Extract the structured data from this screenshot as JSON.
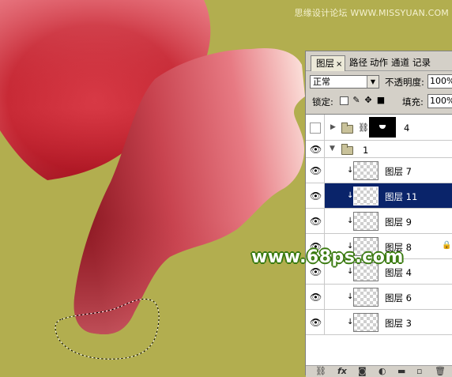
{
  "watermark_top": "思缘设计论坛 WWW.MISSYUAN.COM",
  "watermark_mid": "www.68ps.com",
  "colors": {
    "background": "#b2ae4f",
    "petal": "#d03a48",
    "selection": "#0a246a"
  },
  "panel": {
    "tabs": [
      {
        "label": "图层",
        "close": "×"
      },
      {
        "label": "路径"
      },
      {
        "label": "动作"
      },
      {
        "label": "通道"
      },
      {
        "label": "记录"
      }
    ],
    "blend_mode": "正常",
    "opacity_label": "不透明度:",
    "opacity_value": "100%",
    "lock_label": "锁定:",
    "fill_label": "填充:",
    "fill_value": "100%",
    "layers": [
      {
        "name": "4",
        "type": "group",
        "visible": false,
        "expanded": false
      },
      {
        "name": "1",
        "type": "group",
        "visible": true,
        "expanded": true
      },
      {
        "name": "图层 7",
        "type": "layer",
        "visible": true,
        "clipped": true
      },
      {
        "name": "图层 11",
        "type": "layer",
        "visible": true,
        "clipped": true,
        "selected": true
      },
      {
        "name": "图层 9",
        "type": "layer",
        "visible": true,
        "clipped": true
      },
      {
        "name": "图层 8",
        "type": "layer",
        "visible": true,
        "clipped": true,
        "locked": true
      },
      {
        "name": "图层 4",
        "type": "layer",
        "visible": true,
        "clipped": true
      },
      {
        "name": "图层 6",
        "type": "layer",
        "visible": true,
        "clipped": true
      },
      {
        "name": "图层 3",
        "type": "layer",
        "visible": true,
        "clipped": true
      }
    ],
    "footer_icons": [
      "link-icon",
      "fx-icon",
      "mask-icon",
      "adjustment-icon",
      "new-group-icon",
      "new-layer-icon",
      "trash-icon"
    ]
  }
}
